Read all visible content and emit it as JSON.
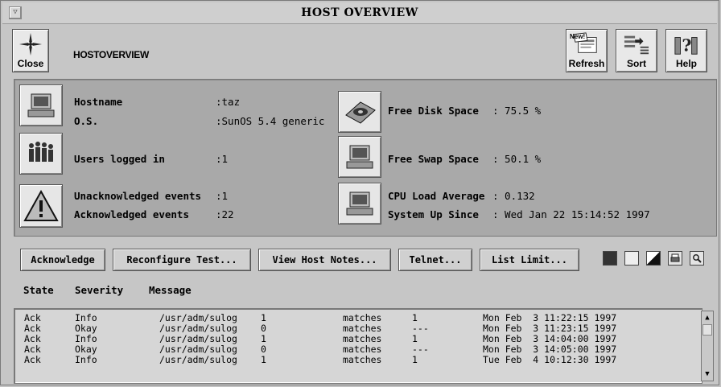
{
  "window": {
    "title": "HOST OVERVIEW",
    "menu_glyph": "▽"
  },
  "toolbar": {
    "heading": "HOSTOVERVIEW",
    "close_label": "Close",
    "refresh_label": "Refresh",
    "refresh_badge": "New!",
    "sort_label": "Sort",
    "help_label": "Help"
  },
  "host": {
    "hostname_label": "Hostname",
    "hostname_value": ":taz",
    "os_label": "O.S.",
    "os_value": ":SunOS 5.4 generic",
    "users_label": "Users logged in",
    "users_value": ":1",
    "unack_label": "Unacknowledged events",
    "unack_value": ":1",
    "ack_label": "Acknowledged events",
    "ack_value": ":22",
    "disk_label": "Free Disk Space",
    "disk_value": ": 75.5 %",
    "swap_label": "Free Swap Space",
    "swap_value": ": 50.1 %",
    "cpu_label": "CPU Load Average",
    "cpu_value": ": 0.132",
    "uptime_label": "System Up Since",
    "uptime_value": ": Wed Jan 22 15:14:52 1997"
  },
  "actions": {
    "acknowledge": "Acknowledge",
    "reconfigure": "Reconfigure Test...",
    "view_notes": "View Host Notes...",
    "telnet": "Telnet...",
    "list_limit": "List Limit..."
  },
  "columns": {
    "state": "State",
    "severity": "Severity",
    "message": "Message"
  },
  "events": [
    {
      "state": "Ack",
      "severity": "Info",
      "file": "/usr/adm/sulog",
      "count": "1",
      "op": "matches",
      "value": "1",
      "date": "Mon Feb  3 11:22:15 1997"
    },
    {
      "state": "Ack",
      "severity": "Okay",
      "file": "/usr/adm/sulog",
      "count": "0",
      "op": "matches",
      "value": "---",
      "date": "Mon Feb  3 11:23:15 1997"
    },
    {
      "state": "Ack",
      "severity": "Info",
      "file": "/usr/adm/sulog",
      "count": "1",
      "op": "matches",
      "value": "1",
      "date": "Mon Feb  3 14:04:00 1997"
    },
    {
      "state": "Ack",
      "severity": "Okay",
      "file": "/usr/adm/sulog",
      "count": "0",
      "op": "matches",
      "value": "---",
      "date": "Mon Feb  3 14:05:00 1997"
    },
    {
      "state": "Ack",
      "severity": "Info",
      "file": "/usr/adm/sulog",
      "count": "1",
      "op": "matches",
      "value": "1",
      "date": "Tue Feb  4 10:12:30 1997"
    }
  ],
  "scrollbar": {
    "up": "▲",
    "down": "▼"
  }
}
